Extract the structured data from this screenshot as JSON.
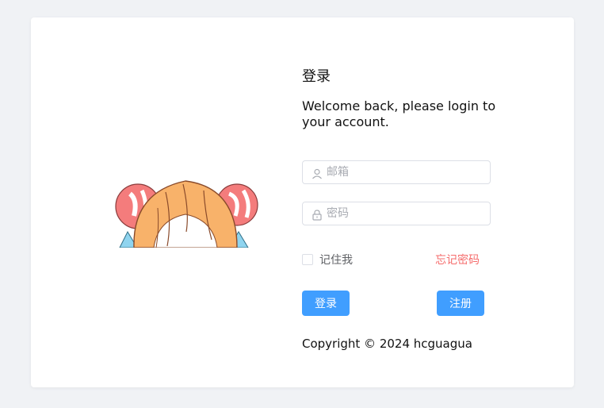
{
  "login": {
    "title": "登录",
    "welcome": "Welcome back, please login to your account.",
    "email_placeholder": "邮箱",
    "password_placeholder": "密码",
    "remember_label": "记住我",
    "forgot_label": "忘记密码",
    "login_button": "登录",
    "register_button": "注册",
    "copyright": "Copyright © 2024 hcguagua"
  },
  "colors": {
    "page_background": "#f0f2f5",
    "primary": "#409eff",
    "danger": "#f56c6c"
  },
  "icons": {
    "email": "user-icon",
    "password": "lock-icon"
  }
}
